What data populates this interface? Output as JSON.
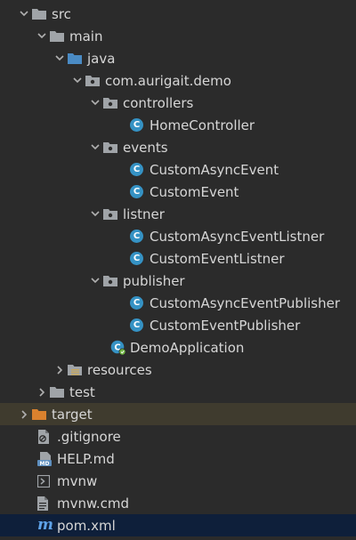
{
  "project_tree": {
    "items": [
      {
        "label": "src"
      },
      {
        "label": "main"
      },
      {
        "label": "java"
      },
      {
        "label": "com.aurigait.demo"
      },
      {
        "label": "controllers"
      },
      {
        "label": "HomeController"
      },
      {
        "label": "events"
      },
      {
        "label": "CustomAsyncEvent"
      },
      {
        "label": "CustomEvent"
      },
      {
        "label": "listner"
      },
      {
        "label": "CustomAsyncEventListner"
      },
      {
        "label": "CustomEventListner"
      },
      {
        "label": "publisher"
      },
      {
        "label": "CustomAsyncEventPublisher"
      },
      {
        "label": "CustomEventPublisher"
      },
      {
        "label": "DemoApplication"
      },
      {
        "label": "resources"
      },
      {
        "label": "test"
      },
      {
        "label": "target"
      },
      {
        "label": ".gitignore"
      },
      {
        "label": "HELP.md"
      },
      {
        "label": "mvnw"
      },
      {
        "label": "mvnw.cmd"
      },
      {
        "label": "pom.xml"
      }
    ]
  },
  "icons": {
    "class_letter": "C",
    "maven_letter": "m",
    "markdown_badge": "MD"
  },
  "colors": {
    "background": "#2b2b2b",
    "folder_gray": "#a0a4a8",
    "source_folder_blue": "#4a8bc4",
    "class_blue": "#3592c4",
    "target_folder_orange": "#d9812e",
    "selection_blue": "#0e1f3a"
  }
}
